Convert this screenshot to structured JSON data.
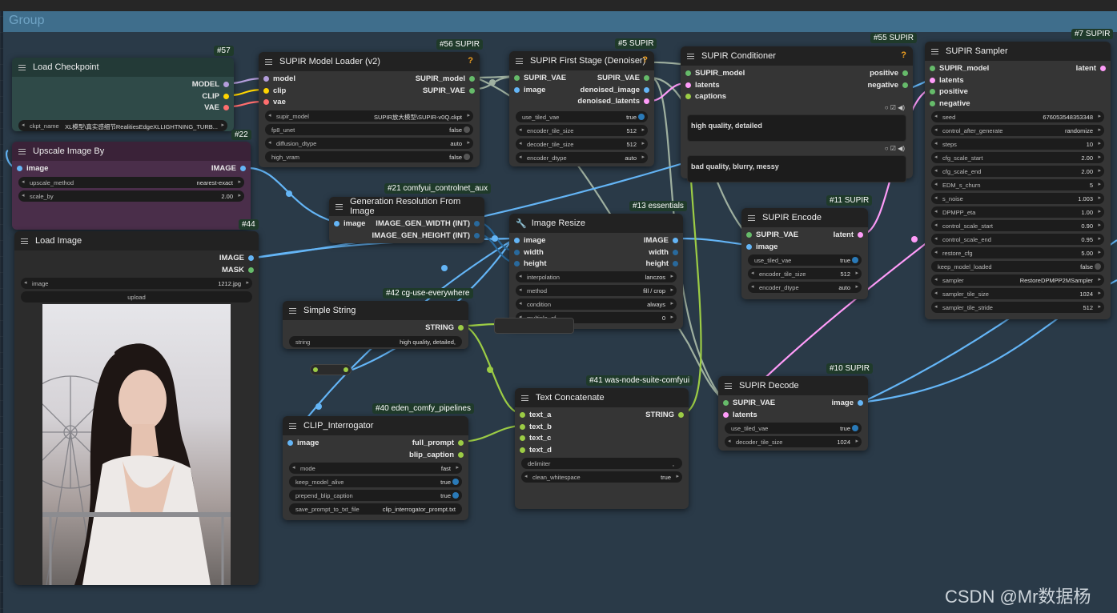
{
  "group": {
    "title": "Group"
  },
  "watermark": "CSDN @Mr数据杨",
  "colors": {
    "model": "#b39ddb",
    "clip": "#ffd500",
    "vae": "#ff6e6e",
    "image": "#64b5f6",
    "supir": "#66bb6a",
    "string": "#9ccc45",
    "latent": "#ff9cf9",
    "int": "#29699c",
    "canvas": "#1c2631",
    "group": "#3f6e8c"
  },
  "nodes": {
    "load_checkpoint": {
      "title": "Load Checkpoint",
      "badge": "#57",
      "outputs": [
        "MODEL",
        "CLIP",
        "VAE"
      ],
      "ckpt_label": "ckpt_name",
      "ckpt_value": "XL模型\\真实感细节RealitiesEdgeXLLIGHTNING_TURB..."
    },
    "upscale": {
      "title": "Upscale Image By",
      "badge": "#22",
      "input": "image",
      "output": "IMAGE",
      "w1k": "upscale_method",
      "w1v": "nearest-exact",
      "w2k": "scale_by",
      "w2v": "2.00"
    },
    "load_image": {
      "title": "Load Image",
      "badge": "#44",
      "out1": "IMAGE",
      "out2": "MASK",
      "w1k": "image",
      "w1v": "1212.jpg",
      "upload": "upload"
    },
    "model_loader": {
      "title": "SUPIR Model Loader (v2)",
      "badge": "#56 SUPIR",
      "inputs": [
        "model",
        "clip",
        "vae"
      ],
      "outputs": [
        "SUPIR_model",
        "SUPIR_VAE"
      ],
      "w1k": "supir_model",
      "w1v": "SUPIR放大模型\\SUPIR-v0Q.ckpt",
      "w2k": "fp8_unet",
      "w2v": "false",
      "w3k": "diffusion_dtype",
      "w3v": "auto",
      "w4k": "high_vram",
      "w4v": "false"
    },
    "first_stage": {
      "title": "SUPIR First Stage (Denoiser)",
      "badge": "#5 SUPIR",
      "inputs": [
        "SUPIR_VAE",
        "image"
      ],
      "outputs": [
        "SUPIR_VAE",
        "denoised_image",
        "denoised_latents"
      ],
      "w1k": "use_tiled_vae",
      "w1v": "true",
      "w2k": "encoder_tile_size",
      "w2v": "512",
      "w3k": "decoder_tile_size",
      "w3v": "512",
      "w4k": "encoder_dtype",
      "w4v": "auto"
    },
    "conditioner": {
      "title": "SUPIR Conditioner",
      "badge": "#55 SUPIR",
      "inputs": [
        "SUPIR_model",
        "latents",
        "captions"
      ],
      "outputs": [
        "positive",
        "negative"
      ],
      "pos_text": "high quality, detailed",
      "neg_text": "bad quality, blurry, messy"
    },
    "sampler": {
      "title": "SUPIR Sampler",
      "badge": "#7 SUPIR",
      "inputs": [
        "SUPIR_model",
        "latents",
        "positive",
        "negative"
      ],
      "output": "latent",
      "widgets": [
        {
          "k": "seed",
          "v": "676053548353348"
        },
        {
          "k": "control_after_generate",
          "v": "randomize"
        },
        {
          "k": "steps",
          "v": "10"
        },
        {
          "k": "cfg_scale_start",
          "v": "2.00"
        },
        {
          "k": "cfg_scale_end",
          "v": "2.00"
        },
        {
          "k": "EDM_s_churn",
          "v": "5"
        },
        {
          "k": "s_noise",
          "v": "1.003"
        },
        {
          "k": "DPMPP_eta",
          "v": "1.00"
        },
        {
          "k": "control_scale_start",
          "v": "0.90"
        },
        {
          "k": "control_scale_end",
          "v": "0.95"
        },
        {
          "k": "restore_cfg",
          "v": "5.00"
        },
        {
          "k": "keep_model_loaded",
          "v": "false"
        },
        {
          "k": "sampler",
          "v": "RestoreDPMPP2MSampler"
        },
        {
          "k": "sampler_tile_size",
          "v": "1024"
        },
        {
          "k": "sampler_tile_stride",
          "v": "512"
        }
      ]
    },
    "gen_res": {
      "title": "Generation Resolution From Image",
      "badge": "#21 comfyui_controlnet_aux",
      "input": "image",
      "out1": "IMAGE_GEN_WIDTH (INT)",
      "out2": "IMAGE_GEN_HEIGHT (INT)"
    },
    "image_resize": {
      "title": "Image Resize",
      "badge": "#13 essentials",
      "inputs": [
        "image",
        "width",
        "height"
      ],
      "outputs": [
        "IMAGE",
        "width",
        "height"
      ],
      "w1k": "interpolation",
      "w1v": "lanczos",
      "w2k": "method",
      "w2v": "fill / crop",
      "w3k": "condition",
      "w3v": "always",
      "w4k": "multiple_of",
      "w4v": "0"
    },
    "simple_string": {
      "title": "Simple String",
      "badge": "#42 cg-use-everywhere",
      "output": "STRING",
      "w1k": "string",
      "w1v": "high quality, detailed,"
    },
    "clip_interrogator": {
      "title": "CLIP_Interrogator",
      "badge": "#40 eden_comfy_pipelines",
      "input": "image",
      "out1": "full_prompt",
      "out2": "blip_caption",
      "w1k": "mode",
      "w1v": "fast",
      "w2k": "keep_model_alive",
      "w2v": "true",
      "w3k": "prepend_blip_caption",
      "w3v": "true",
      "w4k": "save_prompt_to_txt_file",
      "w4v": "clip_interrogator_prompt.txt"
    },
    "text_concat": {
      "title": "Text Concatenate",
      "badge": "#41 was-node-suite-comfyui",
      "inputs": [
        "text_a",
        "text_b",
        "text_c",
        "text_d"
      ],
      "output": "STRING",
      "w1k": "delimiter",
      "w1v": ",",
      "w2k": "clean_whitespace",
      "w2v": "true"
    },
    "encode": {
      "title": "SUPIR Encode",
      "badge": "#11 SUPIR",
      "inputs": [
        "SUPIR_VAE",
        "image"
      ],
      "output": "latent",
      "w1k": "use_tiled_vae",
      "w1v": "true",
      "w2k": "encoder_tile_size",
      "w2v": "512",
      "w3k": "encoder_dtype",
      "w3v": "auto"
    },
    "decode": {
      "title": "SUPIR Decode",
      "badge": "#10 SUPIR",
      "inputs": [
        "SUPIR_VAE",
        "latents"
      ],
      "output": "image",
      "w1k": "use_tiled_vae",
      "w1v": "true",
      "w2k": "decoder_tile_size",
      "w2v": "1024"
    }
  }
}
